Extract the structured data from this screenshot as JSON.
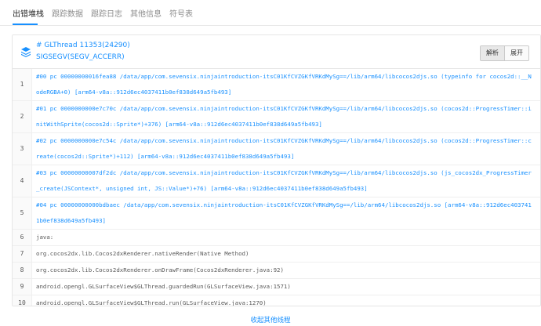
{
  "tabs": [
    {
      "label": "出错堆栈",
      "active": true
    },
    {
      "label": "跟踪数据",
      "active": false
    },
    {
      "label": "跟踪日志",
      "active": false
    },
    {
      "label": "其他信息",
      "active": false
    },
    {
      "label": "符号表",
      "active": false
    }
  ],
  "header": {
    "icon": "layers-icon",
    "thread_title": "# GLThread 11353(24290)",
    "signal": "SIGSEGV(SEGV_ACCERR)",
    "analyze_label": "解析",
    "expand_label": "展开"
  },
  "stack_lines": [
    {
      "no": "1",
      "text": "#00 pc 00000000016fea88 /data/app/com.sevensix.ninjaintroduction-itsC01KfCVZGKfVRKdMySg==/lib/arm64/libcocos2djs.so (typeinfo for cocos2d::__NodeRGBA+0) [arm64-v8a::912d6ec4037411b0ef838d649a5fb493]",
      "frame": true
    },
    {
      "no": "2",
      "text": "#01 pc 0000000000e7c70c /data/app/com.sevensix.ninjaintroduction-itsC01KfCVZGKfVRKdMySg==/lib/arm64/libcocos2djs.so (cocos2d::ProgressTimer::initWithSprite(cocos2d::Sprite*)+376) [arm64-v8a::912d6ec4037411b0ef838d649a5fb493]",
      "frame": true
    },
    {
      "no": "3",
      "text": "#02 pc 0000000000e7c54c /data/app/com.sevensix.ninjaintroduction-itsC01KfCVZGKfVRKdMySg==/lib/arm64/libcocos2djs.so (cocos2d::ProgressTimer::create(cocos2d::Sprite*)+112) [arm64-v8a::912d6ec4037411b0ef838d649a5fb493]",
      "frame": true
    },
    {
      "no": "4",
      "text": "#03 pc 00000000007df2dc /data/app/com.sevensix.ninjaintroduction-itsC01KfCVZGKfVRKdMySg==/lib/arm64/libcocos2djs.so (js_cocos2dx_ProgressTimer_create(JSContext*, unsigned int, JS::Value*)+76) [arm64-v8a::912d6ec4037411b0ef838d649a5fb493]",
      "frame": true
    },
    {
      "no": "5",
      "text": "#04 pc 00000000000bdbaec /data/app/com.sevensix.ninjaintroduction-itsC01KfCVZGKfVRKdMySg==/lib/arm64/libcocos2djs.so [arm64-v8a::912d6ec4037411b0ef838d649a5fb493]",
      "frame": true
    },
    {
      "no": "6",
      "text": "java:",
      "frame": false
    },
    {
      "no": "7",
      "text": "org.cocos2dx.lib.Cocos2dxRenderer.nativeRender(Native Method)",
      "frame": false
    },
    {
      "no": "8",
      "text": "org.cocos2dx.lib.Cocos2dxRenderer.onDrawFrame(Cocos2dxRenderer.java:92)",
      "frame": false
    },
    {
      "no": "9",
      "text": "android.opengl.GLSurfaceView$GLThread.guardedRun(GLSurfaceView.java:1571)",
      "frame": false
    },
    {
      "no": "10",
      "text": "android.opengl.GLSurfaceView$GLThread.run(GLSurfaceView.java:1270)",
      "frame": false
    }
  ],
  "footer": {
    "link_label": "收起其他线程"
  },
  "colors": {
    "accent": "#1890ff",
    "text": "#595959",
    "border": "#e6e6e6"
  }
}
